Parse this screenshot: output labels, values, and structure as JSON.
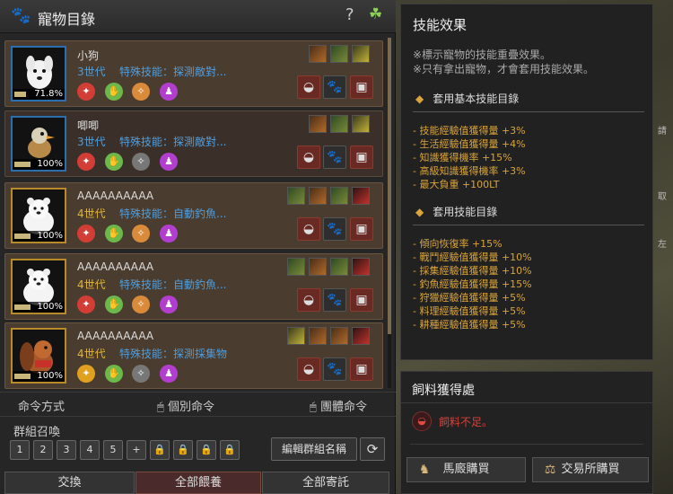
{
  "window": {
    "title": "寵物目錄",
    "help": "?",
    "clover": "☘"
  },
  "pets": [
    {
      "name": "小狗",
      "generation": "3世代",
      "skill": "特殊技能：探測敵對...",
      "hunger": "71.8%",
      "hunger_level": 0.718,
      "gen_color": "blue",
      "portrait": "white-dog"
    },
    {
      "name": "唧唧",
      "generation": "3世代",
      "skill": "特殊技能：探測敵對...",
      "hunger": "100%",
      "hunger_level": 1.0,
      "gen_color": "blue",
      "portrait": "bird"
    },
    {
      "name": "AAAAAAAAAA",
      "generation": "4世代",
      "skill": "特殊技能：自動釣魚...",
      "hunger": "100%",
      "hunger_level": 1.0,
      "gen_color": "gold",
      "portrait": "polar-bear"
    },
    {
      "name": "AAAAAAAAAA",
      "generation": "4世代",
      "skill": "特殊技能：自動釣魚...",
      "hunger": "100%",
      "hunger_level": 1.0,
      "gen_color": "gold",
      "portrait": "polar-bear"
    },
    {
      "name": "AAAAAAAAAA",
      "generation": "4世代",
      "skill": "特殊技能：探測採集物",
      "hunger": "100%",
      "hunger_level": 1.0,
      "gen_color": "gold",
      "portrait": "chipmunk"
    }
  ],
  "command": {
    "label": "命令方式",
    "individual": "個別命令",
    "group": "團體命令"
  },
  "group": {
    "label": "群組召喚",
    "buttons": [
      "1",
      "2",
      "3",
      "4",
      "5",
      "+",
      "🔒",
      "🔒",
      "🔒",
      "🔒"
    ],
    "edit": "編輯群組名稱"
  },
  "bottom": {
    "exchange": "交換",
    "feed_all": "全部餵養",
    "store_all": "全部寄託"
  },
  "effects": {
    "title": "技能效果",
    "notes": [
      "※標示寵物的技能重疊效果。",
      "※只有拿出寵物，才會套用技能效果。"
    ],
    "base_title": "套用基本技能目錄",
    "base": [
      "- 技能經驗值獲得量 +3%",
      "- 生活經驗值獲得量 +4%",
      "- 知識獲得機率 +15%",
      "- 高級知識獲得機率 +3%",
      "- 最大負重 +100LT"
    ],
    "applied_title": "套用技能目錄",
    "applied": [
      "- 傾向恢復率 +15%",
      "- 戰鬥經驗值獲得量 +10%",
      "- 採集經驗值獲得量 +10%",
      "- 釣魚經驗值獲得量 +15%",
      "- 狩獵經驗值獲得量 +5%",
      "- 料理經驗值獲得量 +5%",
      "- 耕種經驗值獲得量 +5%"
    ]
  },
  "feed": {
    "title": "飼料獲得處",
    "message": "飼料不足。",
    "stable": "馬廄購買",
    "market": "交易所購買"
  },
  "edge": {
    "t1": "請",
    "t2": "取",
    "t3": "左"
  }
}
